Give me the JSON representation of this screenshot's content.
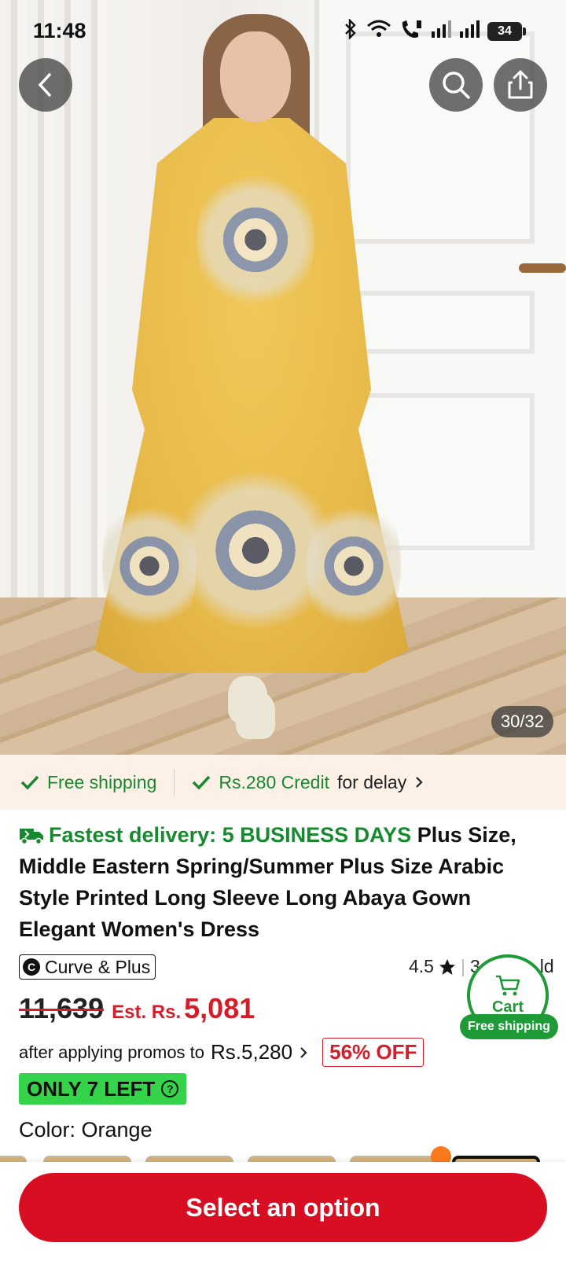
{
  "status_bar": {
    "time": "11:48",
    "battery": "34"
  },
  "gallery": {
    "counter": "30/32"
  },
  "shipping": {
    "free_shipping": "Free shipping",
    "credit_amount": "Rs.280 Credit",
    "credit_suffix": "for delay"
  },
  "product": {
    "fast_delivery": "Fastest delivery: 5 BUSINESS DAYS",
    "title": "Plus Size, Middle Eastern Spring/Summer Plus Size Arabic Style Printed Long Sleeve Long Abaya Gown Elegant Women's Dress",
    "brand_initial": "C",
    "brand": "Curve & Plus",
    "rating": "4.5",
    "sold_visible": "3",
    "sold_suffix": "ld"
  },
  "pricing": {
    "original": "11,639",
    "est_label": "Est. Rs.",
    "est_price": "5,081",
    "promo_prefix": "after applying promos to",
    "promo_price": "Rs.5,280",
    "discount_badge": "56% OFF"
  },
  "stock": {
    "label": "ONLY 7 LEFT"
  },
  "color": {
    "label": "Color: Orange"
  },
  "cart": {
    "label": "Cart",
    "tag": "Free shipping"
  },
  "actions": {
    "select_option": "Select an option"
  },
  "colors": {
    "accent_red": "#d80f22",
    "green": "#168a2e",
    "stock_green": "#34d34a"
  }
}
